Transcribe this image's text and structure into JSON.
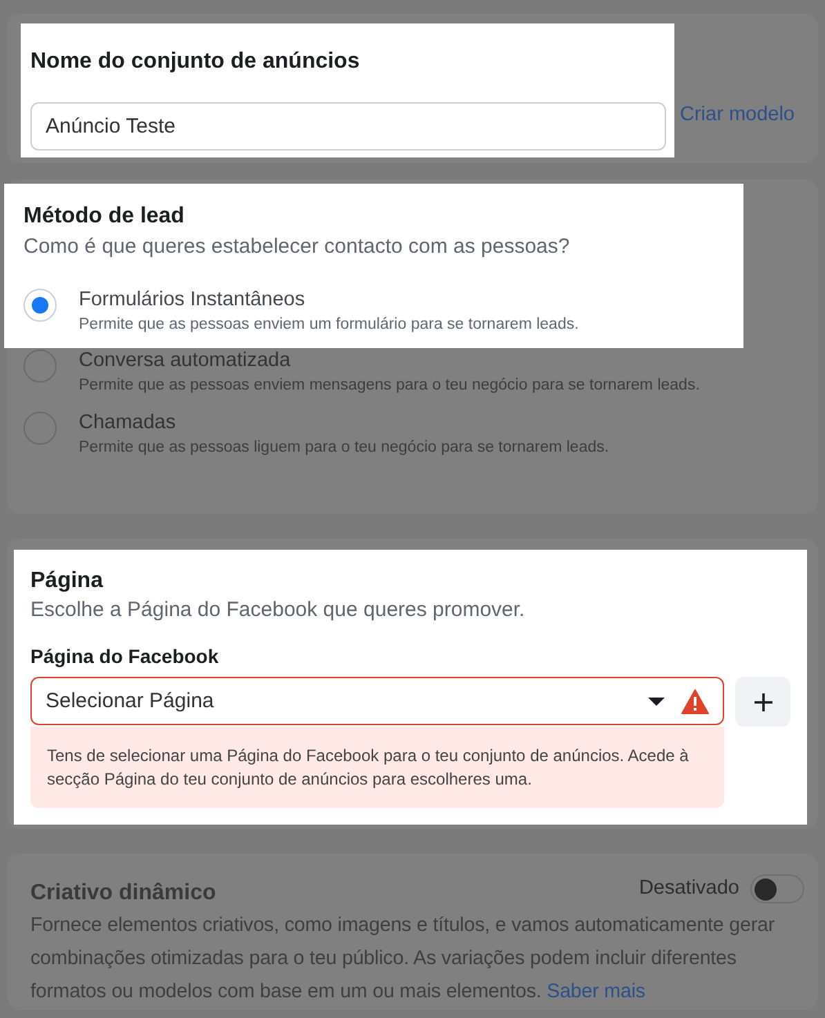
{
  "ad_set_name": {
    "spotlight": true,
    "title": "Nome do conjunto de anúncios",
    "value": "Anúncio Teste",
    "link": "Criar modelo"
  },
  "lead_method": {
    "spotlight": true,
    "title": "Método de lead",
    "subtitle": "Como é que queres estabelecer contacto com as pessoas?",
    "options": [
      {
        "label": "Formulários Instantâneos",
        "description": "Permite que as pessoas enviem um formulário para se tornarem leads.",
        "selected": true,
        "spotlight": true
      },
      {
        "label": "Conversa automatizada",
        "description": "Permite que as pessoas enviem mensagens para o teu negócio para se tornarem leads.",
        "selected": false,
        "spotlight": false
      },
      {
        "label": "Chamadas",
        "description": "Permite que as pessoas liguem para o teu negócio para se tornarem leads.",
        "selected": false,
        "spotlight": false
      }
    ]
  },
  "page": {
    "spotlight": true,
    "title": "Página",
    "subtitle": "Escolhe a Página do Facebook que queres promover.",
    "field_label": "Página do Facebook",
    "select": {
      "placeholder": "Selecionar Página",
      "error": true
    },
    "error_message": "Tens de selecionar uma Página do Facebook para o teu conjunto de anúncios. Acede à secção Página do teu conjunto de anúncios para escolheres uma."
  },
  "dynamic_creative": {
    "title": "Criativo dinâmico",
    "toggle": {
      "label": "Desativado",
      "on": false
    },
    "description": "Fornece elementos criativos, como imagens e títulos, e vamos automaticamente gerar combinações otimizadas para o teu público. As variações podem incluir diferentes formatos ou modelos com base em um ou mais elementos.",
    "link": "Saber mais"
  }
}
